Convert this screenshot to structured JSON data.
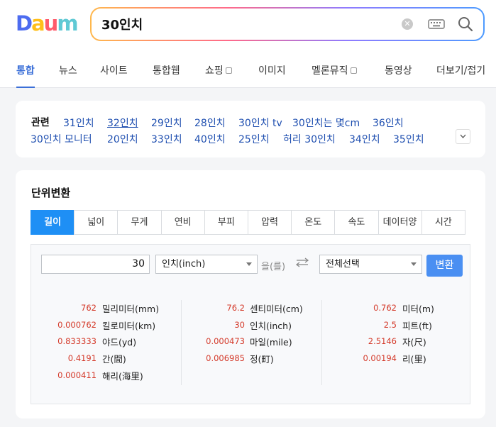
{
  "logo": {
    "letters": [
      "D",
      "a",
      "u",
      "m"
    ],
    "colors": [
      "#4d6cf0",
      "#ffbf1a",
      "#ff5a6a",
      "#5fc9d4"
    ]
  },
  "search": {
    "value": "30인치",
    "clear_icon": "clear-icon",
    "keyboard_icon": "keyboard-icon",
    "search_icon": "search-icon"
  },
  "nav_tabs": [
    "통합",
    "뉴스",
    "사이트",
    "통합웹",
    "쇼핑",
    "이미지",
    "멜론뮤직",
    "동영상",
    "더보기/접기"
  ],
  "related": {
    "label": "관련",
    "items": [
      "31인치",
      "32인치",
      "29인치",
      "28인치",
      "30인치 tv",
      "30인치는 몇cm",
      "36인치",
      "30인치 모니터",
      "20인치",
      "33인치",
      "40인치",
      "25인치",
      "허리 30인치",
      "34인치",
      "35인치"
    ]
  },
  "converter": {
    "title": "단위변환",
    "tabs": [
      "길이",
      "넓이",
      "무게",
      "연비",
      "부피",
      "압력",
      "온도",
      "속도",
      "데이터양",
      "시간"
    ],
    "input_value": "30",
    "from_unit": "인치(inch)",
    "eul": "을(를)",
    "to_unit": "전체선택",
    "convert_button": "변환",
    "results": [
      [
        {
          "value": "762",
          "unit": "밀리미터(mm)"
        },
        {
          "value": "0.000762",
          "unit": "킬로미터(km)"
        },
        {
          "value": "0.833333",
          "unit": "야드(yd)"
        },
        {
          "value": "0.4191",
          "unit": "간(間)"
        },
        {
          "value": "0.000411",
          "unit": "해리(海里)"
        }
      ],
      [
        {
          "value": "76.2",
          "unit": "센티미터(cm)"
        },
        {
          "value": "30",
          "unit": "인치(inch)"
        },
        {
          "value": "0.000473",
          "unit": "마일(mile)"
        },
        {
          "value": "0.006985",
          "unit": "정(町)"
        }
      ],
      [
        {
          "value": "0.762",
          "unit": "미터(m)"
        },
        {
          "value": "2.5",
          "unit": "피트(ft)"
        },
        {
          "value": "2.5146",
          "unit": "자(尺)"
        },
        {
          "value": "0.00194",
          "unit": "리(里)"
        }
      ]
    ]
  },
  "colors": {
    "accent": "#3b6fd8",
    "tab_active": "#1e8ff5",
    "result_value": "#d43a2a",
    "button": "#4a8ff2"
  }
}
